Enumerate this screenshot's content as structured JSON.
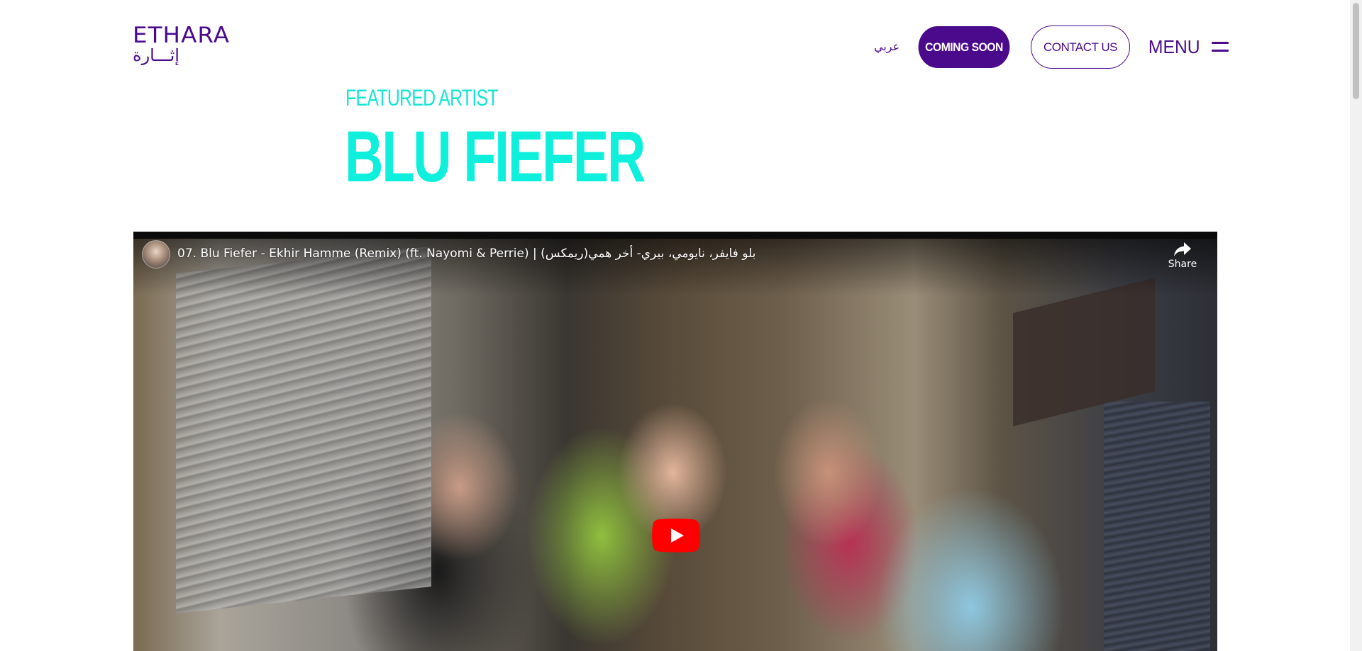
{
  "header": {
    "logo_latin": "ETHARA",
    "logo_arabic": "إثـــارة",
    "language_link": "عربي",
    "coming_soon_label": "COMING SOON",
    "contact_label": "CONTACT US",
    "menu_label": "MENU"
  },
  "main": {
    "eyebrow": "FEATURED ARTIST",
    "artist_name": "BLU FIEFER"
  },
  "video": {
    "title": "07. Blu Fiefer - Ekhir Hamme (Remix) (ft. Nayomi & Perrie) | بلو فايفر، نايومي، بيري- أخر همي(ريمكس)",
    "share_label": "Share",
    "play_icon": "youtube-play-icon",
    "share_icon": "share-arrow-icon"
  },
  "colors": {
    "brand_purple": "#4b0a8c",
    "accent_cyan": "#0ff0dc",
    "youtube_red": "#ff0000"
  }
}
